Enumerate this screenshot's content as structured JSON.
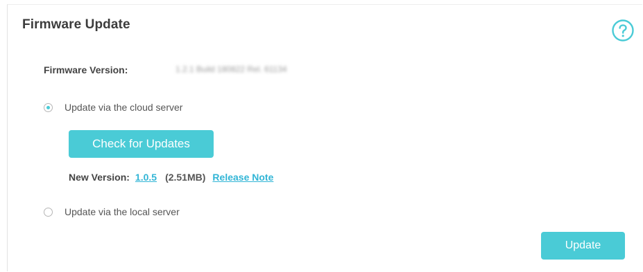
{
  "title": "Firmware Update",
  "help_icon": "question-circle-icon",
  "firmware": {
    "label": "Firmware Version:",
    "value": "1.2.1 Build 180822 Rel. 61134"
  },
  "options": {
    "cloud_label": "Update via the cloud server",
    "cloud_selected": true,
    "local_label": "Update via the local server",
    "local_selected": false
  },
  "check_button": "Check for Updates",
  "new_version": {
    "label": "New Version:",
    "version": "1.0.5",
    "size": "(2.51MB)",
    "release_note": "Release Note"
  },
  "update_button": "Update",
  "colors": {
    "accent": "#4acbd6",
    "link": "#31b5d6"
  }
}
